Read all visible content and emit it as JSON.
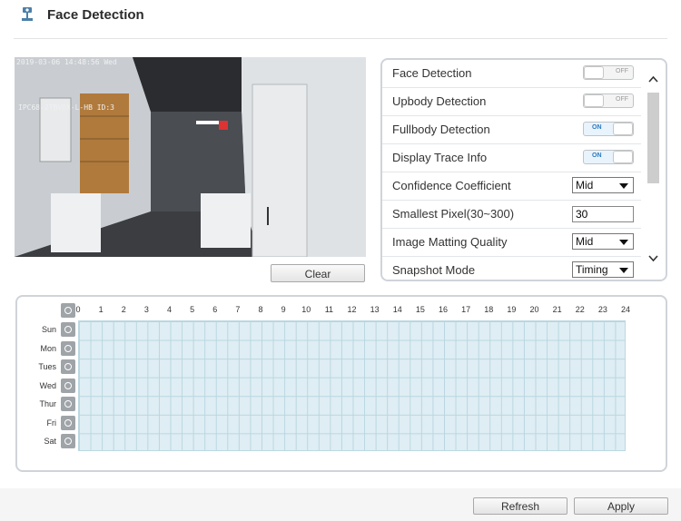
{
  "header": {
    "title": "Face Detection",
    "icon": "camera-setting-icon"
  },
  "video": {
    "osd_time": "2019-03-06 14:48:56 Wed",
    "osd_channel": "IPC68-2TBVDX-L-HB ID:3"
  },
  "clear_label": "Clear",
  "settings": {
    "rows": [
      {
        "label": "Face Detection",
        "type": "toggle",
        "state": "OFF"
      },
      {
        "label": "Upbody Detection",
        "type": "toggle",
        "state": "OFF"
      },
      {
        "label": "Fullbody Detection",
        "type": "toggle",
        "state": "ON"
      },
      {
        "label": "Display Trace Info",
        "type": "toggle",
        "state": "ON"
      },
      {
        "label": "Confidence Coefficient",
        "type": "select",
        "value": "Mid"
      },
      {
        "label": "Smallest Pixel(30~300)",
        "type": "input",
        "value": "30"
      },
      {
        "label": "Image Matting Quality",
        "type": "select",
        "value": "Mid"
      },
      {
        "label": "Snapshot Mode",
        "type": "select",
        "value": "Timing"
      }
    ]
  },
  "schedule": {
    "hours": [
      "0",
      "1",
      "2",
      "3",
      "4",
      "5",
      "6",
      "7",
      "8",
      "9",
      "10",
      "11",
      "12",
      "13",
      "14",
      "15",
      "16",
      "17",
      "18",
      "19",
      "20",
      "21",
      "22",
      "23",
      "24"
    ],
    "days": [
      "Sun",
      "Mon",
      "Tues",
      "Wed",
      "Thur",
      "Fri",
      "Sat"
    ]
  },
  "buttons": {
    "refresh": "Refresh",
    "apply": "Apply"
  },
  "colors": {
    "grid_fill": "#dfeef4",
    "grid_line": "#b9d6e0",
    "toggle_on_text": "#2a7ac0"
  }
}
